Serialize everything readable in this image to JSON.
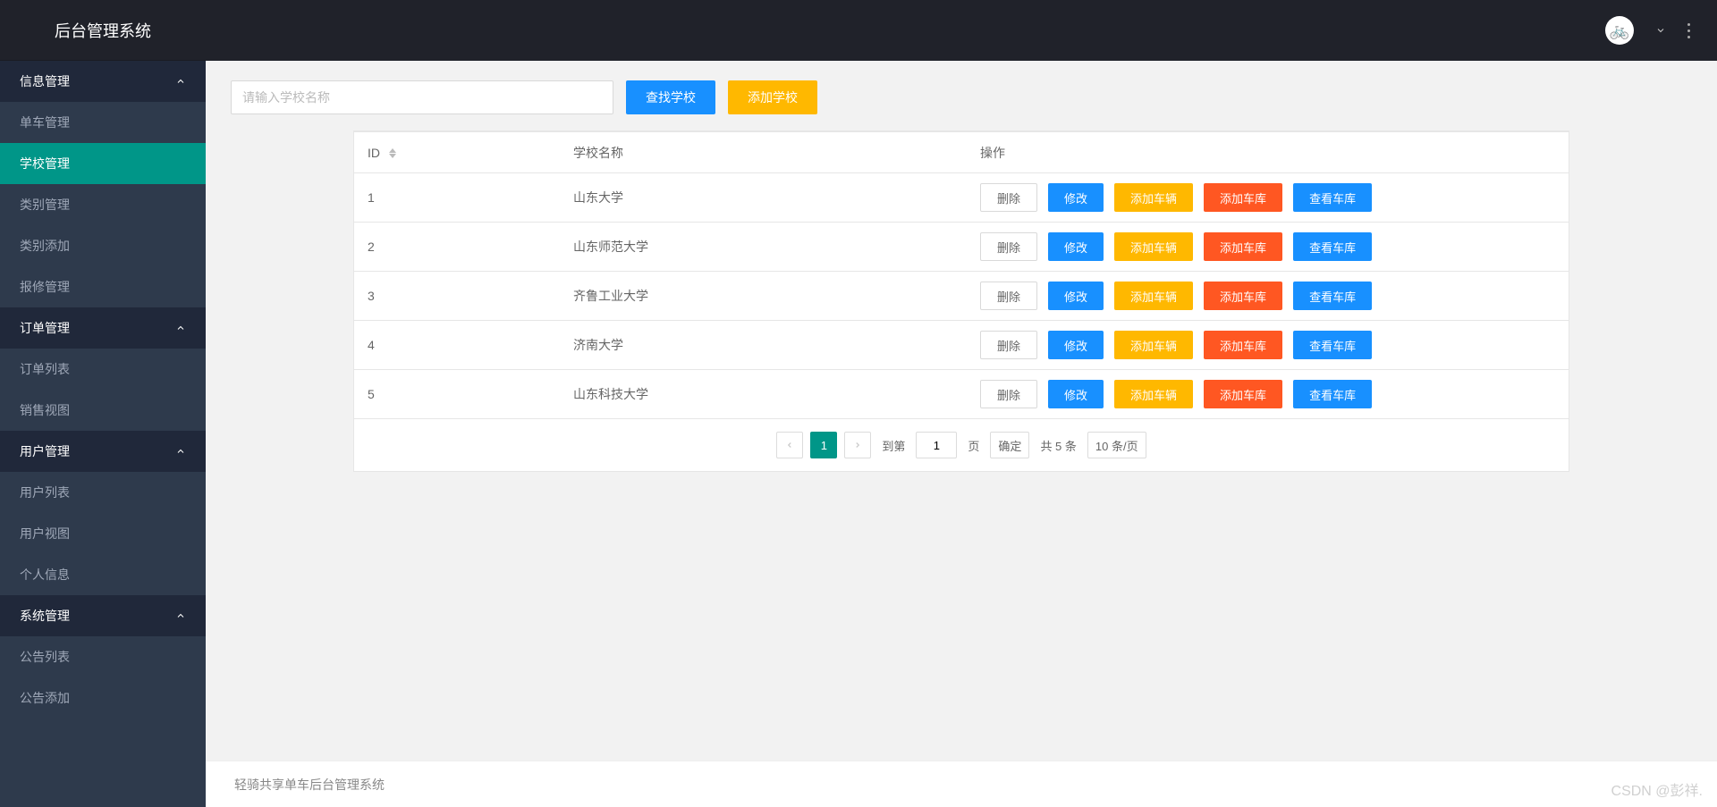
{
  "app_title": "后台管理系统",
  "sidebar": {
    "groups": [
      {
        "label": "信息管理",
        "items": [
          {
            "label": "单车管理"
          },
          {
            "label": "学校管理",
            "active": true
          },
          {
            "label": "类别管理"
          },
          {
            "label": "类别添加"
          },
          {
            "label": "报修管理"
          }
        ]
      },
      {
        "label": "订单管理",
        "items": [
          {
            "label": "订单列表"
          },
          {
            "label": "销售视图"
          }
        ]
      },
      {
        "label": "用户管理",
        "items": [
          {
            "label": "用户列表"
          },
          {
            "label": "用户视图"
          },
          {
            "label": "个人信息"
          }
        ]
      },
      {
        "label": "系统管理",
        "items": [
          {
            "label": "公告列表"
          },
          {
            "label": "公告添加"
          }
        ]
      }
    ]
  },
  "toolbar": {
    "search_placeholder": "请输入学校名称",
    "search_label": "查找学校",
    "add_label": "添加学校"
  },
  "table": {
    "columns": {
      "id": "ID",
      "name": "学校名称",
      "ops": "操作"
    },
    "op_labels": {
      "delete": "删除",
      "edit": "修改",
      "add_vehicle": "添加车辆",
      "add_garage": "添加车库",
      "view_garage": "查看车库"
    },
    "rows": [
      {
        "id": "1",
        "name": "山东大学"
      },
      {
        "id": "2",
        "name": "山东师范大学"
      },
      {
        "id": "3",
        "name": "齐鲁工业大学"
      },
      {
        "id": "4",
        "name": "济南大学"
      },
      {
        "id": "5",
        "name": "山东科技大学"
      }
    ]
  },
  "pagination": {
    "current": "1",
    "goto_prefix": "到第",
    "goto_suffix": "页",
    "confirm": "确定",
    "total_text": "共 5 条",
    "page_size": "10 条/页",
    "goto_value": "1"
  },
  "footer": {
    "text": "轻骑共享单车后台管理系统"
  },
  "watermark": "CSDN @彭祥."
}
